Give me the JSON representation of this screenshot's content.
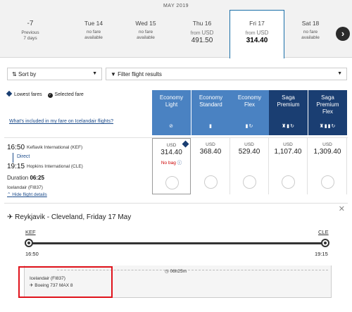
{
  "date_strip": {
    "month": "MAY 2019",
    "prev": {
      "label": "-7",
      "sub1": "Previous",
      "sub2": "7 days"
    },
    "days": [
      {
        "name": "Tue 14",
        "line1": "no fare",
        "line2": "available"
      },
      {
        "name": "Wed 15",
        "line1": "no fare",
        "line2": "available"
      },
      {
        "name": "Thu 16",
        "from": "from",
        "currency": "USD",
        "price": "491.50"
      },
      {
        "name": "Fri 17",
        "from": "from",
        "currency": "USD",
        "price": "314.40"
      },
      {
        "name": "Sat 18",
        "line1": "no fare",
        "line2": "available"
      }
    ],
    "next_icon": "›"
  },
  "controls": {
    "sort_label": "Sort by",
    "filter_label": "Filter flight results"
  },
  "legend": {
    "lowest": "Lowest fares",
    "selected": "Selected fare",
    "info_link": "What's included in my fare on Icelandair flights?"
  },
  "fares": [
    {
      "l1": "Economy",
      "l2": "Light",
      "l3": "",
      "icons": "⊘"
    },
    {
      "l1": "Economy",
      "l2": "Standard",
      "l3": "",
      "icons": "▮"
    },
    {
      "l1": "Economy",
      "l2": "Flex",
      "l3": "",
      "icons": "▮↻"
    },
    {
      "l1": "Saga",
      "l2": "Premium",
      "l3": "",
      "icons": "♜▮↻"
    },
    {
      "l1": "Saga",
      "l2": "Premium",
      "l3": "Flex",
      "icons": "♜▮▮↻"
    }
  ],
  "flight": {
    "dep_time": "16:50",
    "dep_airport": "Keflavik International (KEF)",
    "stops": "Direct",
    "arr_time": "19:15",
    "arr_airport": "Hopkins International (CLE)",
    "duration_label": "Duration",
    "duration": "06:25",
    "airline": "Icelandair (FI837)",
    "hide_link": "Hide flight details",
    "prices": [
      {
        "currency": "USD",
        "amount": "314.40",
        "note": "No bag"
      },
      {
        "currency": "USD",
        "amount": "368.40"
      },
      {
        "currency": "USD",
        "amount": "529.40"
      },
      {
        "currency": "USD",
        "amount": "1,107.40"
      },
      {
        "currency": "USD",
        "amount": "1,309.40"
      }
    ]
  },
  "details": {
    "title": "Reykjavik - Cleveland, Friday 17 May",
    "from_code": "KEF",
    "to_code": "CLE",
    "dep_time": "16:50",
    "arr_time": "19:15",
    "segment_duration": "06h25m",
    "airline": "Icelandair (FI837)",
    "aircraft": "Boeing 737 MAX 8"
  },
  "colors": {
    "economy": "#4a82c2",
    "saga": "#1a3e72",
    "highlight": "#e0131c"
  }
}
